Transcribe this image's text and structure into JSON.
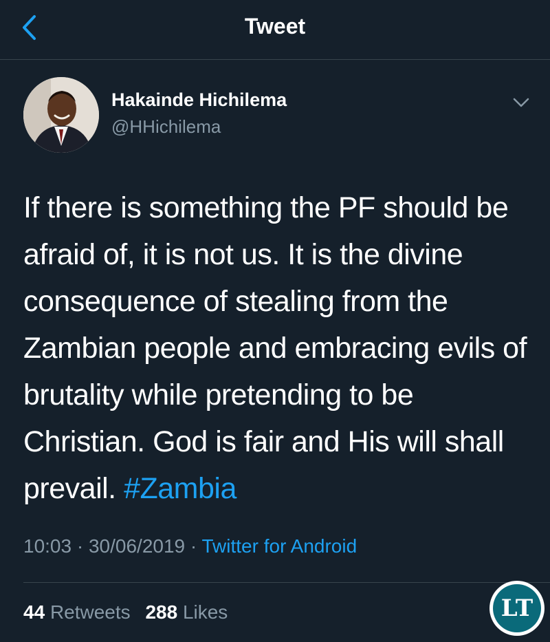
{
  "header": {
    "title": "Tweet"
  },
  "tweet": {
    "author_name": "Hakainde Hichilema",
    "author_handle": "@HHichilema",
    "text": "If there is something the PF should be afraid of, it is not us. It is the divine consequence of stealing from the Zambian people and embracing evils of brutality while pretending to be Christian. God is fair and His will shall prevail. ",
    "hashtag": "#Zambia",
    "time": "10:03",
    "date": "30/06/2019",
    "separator": "·",
    "source": "Twitter for Android",
    "retweets_count": "44",
    "retweets_label": "Retweets",
    "likes_count": "288",
    "likes_label": "Likes"
  },
  "watermark": {
    "text": "LT"
  },
  "colors": {
    "background": "#15202b",
    "accent": "#1da1f2",
    "secondary_text": "#8899a6",
    "divider": "#38444d"
  },
  "icons": {
    "back": "chevron-left-icon",
    "menu": "chevron-down-icon"
  }
}
